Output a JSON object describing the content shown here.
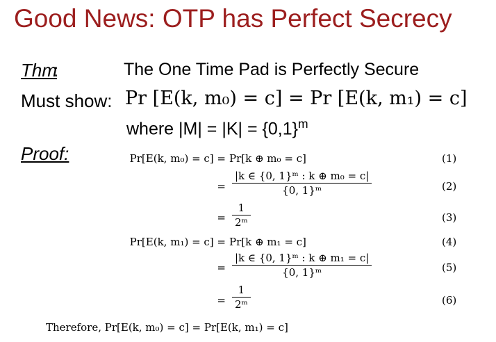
{
  "slide": {
    "title": "Good News: OTP has Perfect Secrecy",
    "thm_label": "Thm",
    "thm_colon": ":",
    "thm_text": "The One Time Pad is Perfectly Secure",
    "must_label": "Must show:",
    "must_formula": "Pr [E(k, m₀) = c] = Pr [E(k, m₁) = c]",
    "where_line": "where |M| = |K| = {0,1}",
    "where_sup": "m",
    "proof_label": "Proof:",
    "equations": [
      {
        "lhs": "Pr[E(k, m₀) = c] =",
        "rhs": "Pr[k ⊕ m₀ = c]",
        "number": "(1)"
      },
      {
        "lhs": "=",
        "rhs_num": "|k ∈ {0, 1}ᵐ : k ⊕ m₀ = c|",
        "rhs_den": "{0, 1}ᵐ",
        "number": "(2)"
      },
      {
        "lhs": "=",
        "rhs_num": "1",
        "rhs_den": "2ᵐ",
        "number": "(3)"
      },
      {
        "lhs": "Pr[E(k, m₁) = c] =",
        "rhs": "Pr[k ⊕ m₁ = c]",
        "number": "(4)"
      },
      {
        "lhs": "=",
        "rhs_num": "|k ∈ {0, 1}ᵐ : k ⊕ m₁ = c|",
        "rhs_den": "{0, 1}ᵐ",
        "number": "(5)"
      },
      {
        "lhs": "=",
        "rhs_num": "1",
        "rhs_den": "2ᵐ",
        "number": "(6)"
      }
    ],
    "therefore": "Therefore, Pr[E(k, m₀) = c] = Pr[E(k, m₁) = c]"
  }
}
